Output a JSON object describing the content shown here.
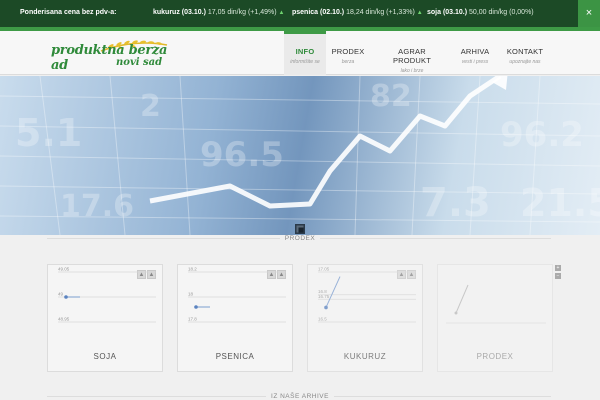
{
  "ticker": {
    "title": "Ponderisana cena bez pdv-a:",
    "items": [
      {
        "name": "kukuruz (03.10.)",
        "value": "17,05 din/kg (+1,49%)"
      },
      {
        "name": "psenica (02.10.)",
        "value": "18,24 din/kg (+1,33%)"
      },
      {
        "name": "soja (03.10.)",
        "value": "50,00 din/kg (0,00%)"
      }
    ],
    "close_label": "×"
  },
  "logo": {
    "line1": "produktna berza ad",
    "line2": "novi sad"
  },
  "nav": [
    {
      "label": "INFO",
      "sub": "informišite se",
      "active": true
    },
    {
      "label": "PRODEX",
      "sub": "berza",
      "active": false
    },
    {
      "label": "AGRAR PRODUKT",
      "sub": "lako i brze",
      "active": false
    },
    {
      "label": "ARHIVA",
      "sub": "vesti i press",
      "active": false
    },
    {
      "label": "KONTAKT",
      "sub": "upoznajte nas",
      "active": false
    }
  ],
  "sections": {
    "prodex": "PRODEX",
    "archive": "IZ NAŠE ARHIVE"
  },
  "cards": [
    {
      "title": "SOJA",
      "ticks": [
        "49.05",
        "49",
        "48.95"
      ],
      "points": [
        [
          0.0,
          49
        ],
        [
          1.0,
          49
        ]
      ]
    },
    {
      "title": "PSENICA",
      "ticks": [
        "18.2",
        "18",
        "17.8"
      ],
      "points": [
        [
          0.0,
          17.92
        ],
        [
          1.0,
          17.92
        ]
      ]
    },
    {
      "title": "KUKURUZ",
      "ticks": [
        "17.05",
        "16.8",
        "16.75",
        "16.5"
      ],
      "points": [
        [
          0.0,
          16.66
        ],
        [
          1.0,
          17.0
        ]
      ]
    },
    {
      "title": "PRODEX",
      "ticks": [],
      "points": []
    }
  ],
  "colors": {
    "ticker_bg": "#1c4a26",
    "accent": "#3e9a46",
    "up": "#6fd36f"
  }
}
